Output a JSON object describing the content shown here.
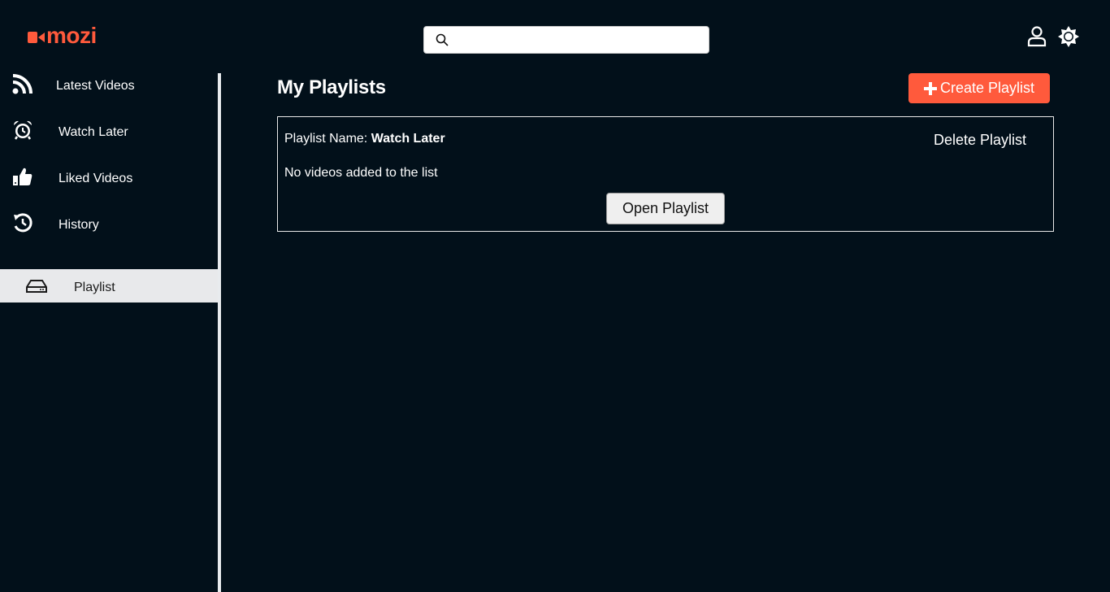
{
  "brand": {
    "name": "mozi",
    "color": "#ff5a3c"
  },
  "header": {
    "search": {
      "value": "",
      "placeholder": ""
    },
    "icons": [
      "user-icon",
      "theme-toggle-icon"
    ]
  },
  "sidebar": {
    "items": [
      {
        "label": "Latest Videos",
        "icon": "rss-icon",
        "active": false
      },
      {
        "label": "Watch Later",
        "icon": "alarm-clock-icon",
        "active": false
      },
      {
        "label": "Liked Videos",
        "icon": "thumbs-up-icon",
        "active": false
      },
      {
        "label": "History",
        "icon": "history-icon",
        "active": false
      },
      {
        "label": "Playlist",
        "icon": "hard-drive-icon",
        "active": true
      }
    ]
  },
  "main": {
    "title": "My Playlists",
    "create_label": "Create Playlist",
    "playlists": [
      {
        "name_label": "Playlist Name: ",
        "name": "Watch Later",
        "delete_label": "Delete Playlist",
        "empty_text": "No videos added to the list",
        "open_label": "Open Playlist"
      }
    ]
  }
}
